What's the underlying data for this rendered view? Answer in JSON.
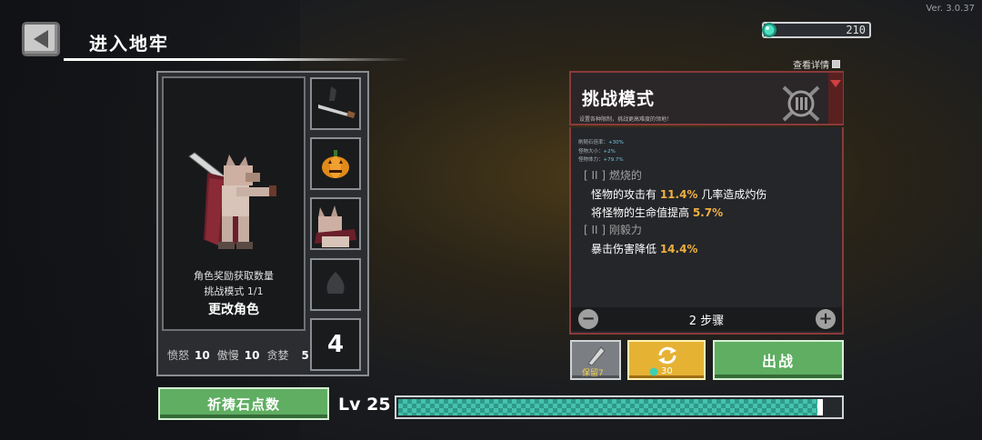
{
  "version": "Ver. 3.0.37",
  "header": {
    "title": "进入地牢"
  },
  "currency": {
    "gems": "210",
    "color": "#3fd0b0"
  },
  "character": {
    "reward_label": "角色奖励获取数量",
    "challenge_count": "挑战模式 1/1",
    "change_button": "更改角色",
    "slot_number": "4",
    "slots": [
      "sword-weapon-icon",
      "pumpkin-pet-icon",
      "character-portrait-icon",
      "locked-slot-icon"
    ]
  },
  "stats": [
    {
      "label": "愤怒",
      "value": "10"
    },
    {
      "label": "傲慢",
      "value": "10"
    },
    {
      "label": "贪婪",
      "value": "5"
    }
  ],
  "challenge": {
    "title": "挑战模式",
    "subtitle": "设置各种限制，挑战更高难度的领地！",
    "details_link": "查看详情",
    "mini_stats": [
      {
        "label": "刷随石倍率：",
        "value": "+30%"
      },
      {
        "label": "怪物大小：",
        "value": "+2%"
      },
      {
        "label": "怪物体力：",
        "value": "+79.7%"
      }
    ],
    "effects": [
      {
        "category": "[ II ] 燃烧的",
        "lines": [
          {
            "pre": "怪物的攻击有 ",
            "hl": "11.4%",
            "post": " 几率造成灼伤"
          },
          {
            "pre": "将怪物的生命值提高 ",
            "hl": "5.7%",
            "post": ""
          }
        ]
      },
      {
        "category": "[ II ] 刚毅力",
        "lines": [
          {
            "pre": "暴击伤害降低 ",
            "hl": "14.4%",
            "post": ""
          }
        ]
      }
    ],
    "steps": "2 步骤"
  },
  "actions": {
    "keep_label": "保留",
    "keep_count": "7",
    "refresh_cost": "30",
    "go_label": "出战",
    "pray_label": "祈祷石点数"
  },
  "level": {
    "label": "Lv 25",
    "progress": 0.96
  }
}
